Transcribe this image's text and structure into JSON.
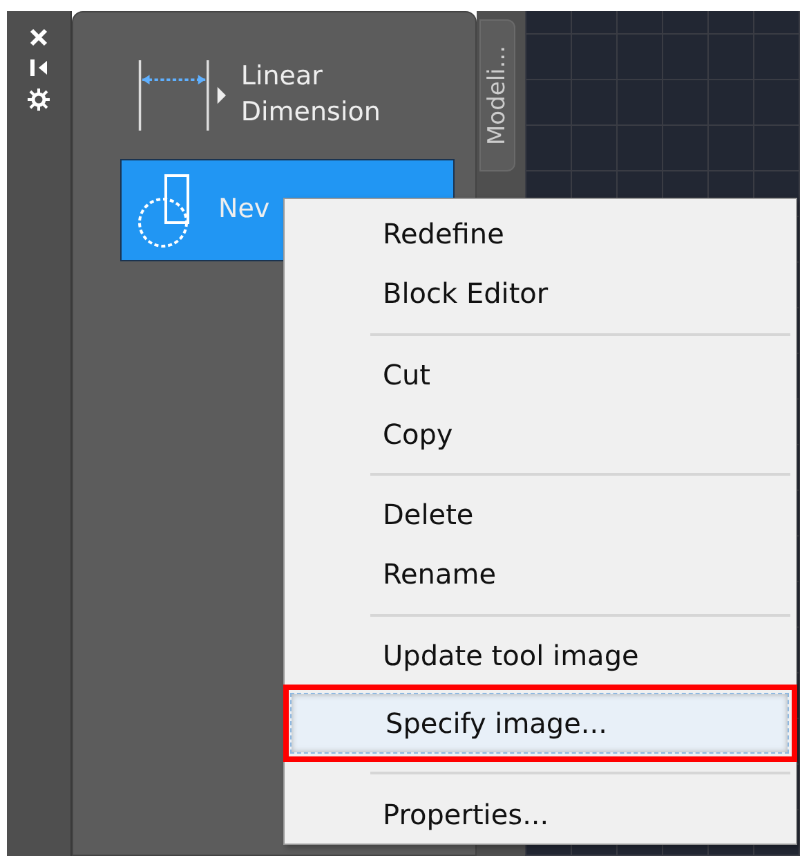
{
  "palette": {
    "tools": [
      {
        "kind": "flyout",
        "label": "Linear Dimension",
        "selected": false
      },
      {
        "kind": "plain",
        "label": "Nev",
        "selected": true
      }
    ],
    "tabs": [
      {
        "label": "Modeli..."
      }
    ]
  },
  "context_menu": {
    "groups": [
      [
        {
          "label": "Redefine",
          "selected": false
        },
        {
          "label": "Block Editor",
          "selected": false
        }
      ],
      [
        {
          "label": "Cut",
          "selected": false
        },
        {
          "label": "Copy",
          "selected": false
        }
      ],
      [
        {
          "label": "Delete",
          "selected": false
        },
        {
          "label": "Rename",
          "selected": false
        }
      ],
      [
        {
          "label": "Update tool image",
          "selected": false
        },
        {
          "label": "Specify image...",
          "selected": true,
          "annotated": true
        }
      ],
      [
        {
          "label": "Properties...",
          "selected": false
        }
      ]
    ]
  }
}
